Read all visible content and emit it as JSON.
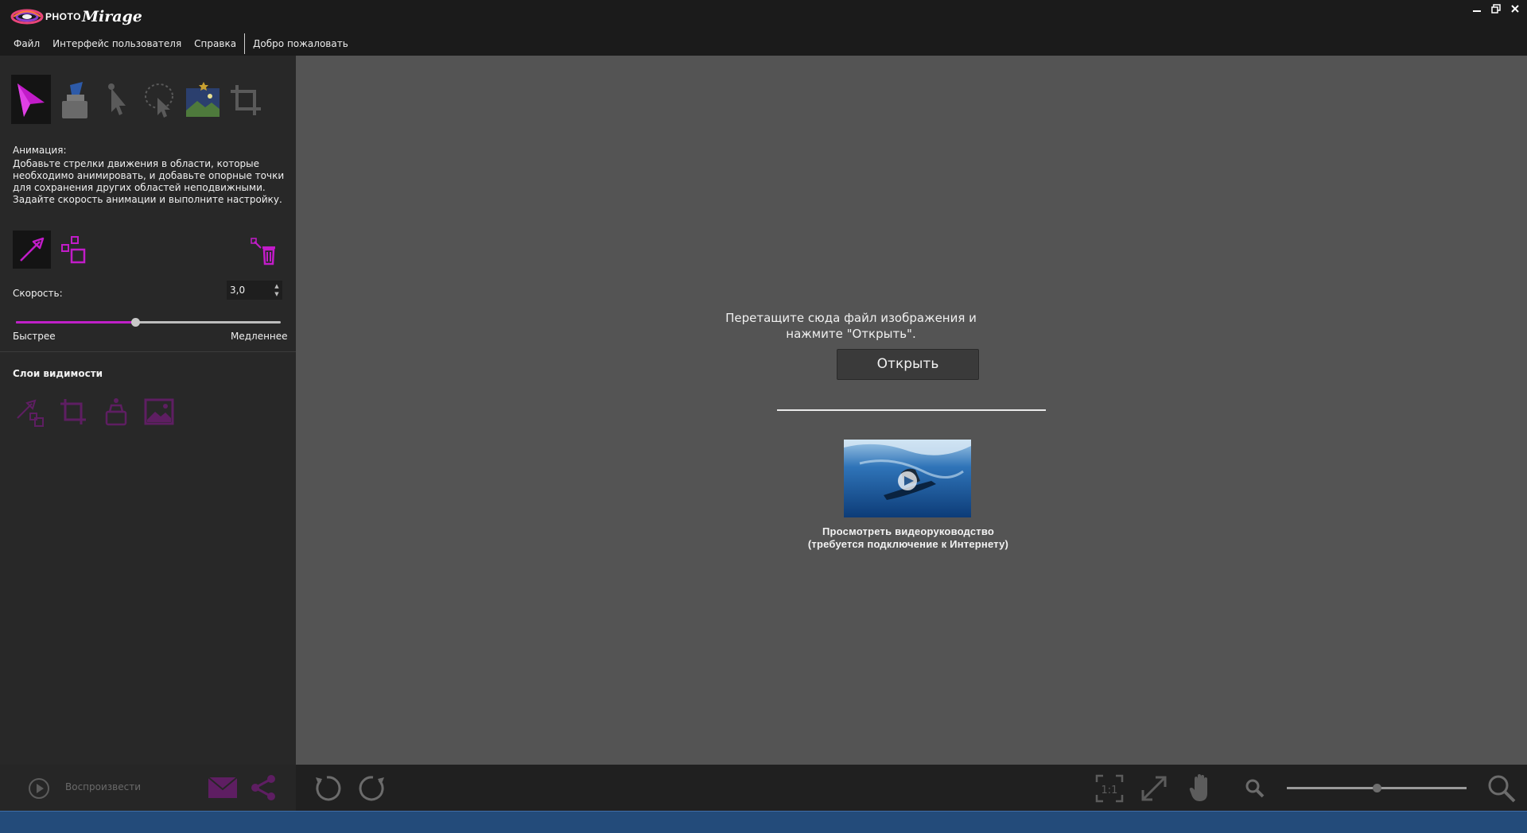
{
  "app": {
    "brand_small": "PHOTO",
    "brand_big": "Mirage"
  },
  "window_controls": {
    "minimize_icon": "minimize-icon",
    "restore_icon": "restore-icon",
    "close_icon": "close-icon"
  },
  "menu": {
    "items": [
      "Файл",
      "Интерфейс пользователя",
      "Справка",
      "Добро пожаловать"
    ]
  },
  "tools": [
    {
      "name": "animation-tool-icon",
      "active": true
    },
    {
      "name": "mask-tool-icon",
      "active": false
    },
    {
      "name": "anchor-tool-icon",
      "active": false
    },
    {
      "name": "selection-tool-icon",
      "active": false
    },
    {
      "name": "sky-replace-tool-icon",
      "active": false
    },
    {
      "name": "crop-tool-icon",
      "active": false
    }
  ],
  "animation": {
    "title": "Анимация:",
    "description": "Добавьте стрелки движения в области, которые необходимо анимировать, и добавьте опорные точки для сохранения других областей неподвижными. Задайте скорость анимации и выполните настройку."
  },
  "speed": {
    "label": "Скорость:",
    "value": "3,0",
    "slider_fraction": 0.45,
    "faster_label": "Быстрее",
    "slower_label": "Медленнее"
  },
  "layers": {
    "title": "Слои видимости"
  },
  "canvas": {
    "drop_text_line1": "Перетащите сюда файл изображения и",
    "drop_text_line2": "нажмите \"Открыть\".",
    "open_button": "Открыть",
    "video_caption_line1": "Просмотреть видеоруководство",
    "video_caption_line2": "(требуется подключение к Интернету)"
  },
  "bottom": {
    "play_label": "Воспроизвести",
    "zoom_fraction": 0.5
  },
  "colors": {
    "accent": "#c020c8",
    "canvas_bg": "#545454",
    "panel_bg": "#282828"
  }
}
